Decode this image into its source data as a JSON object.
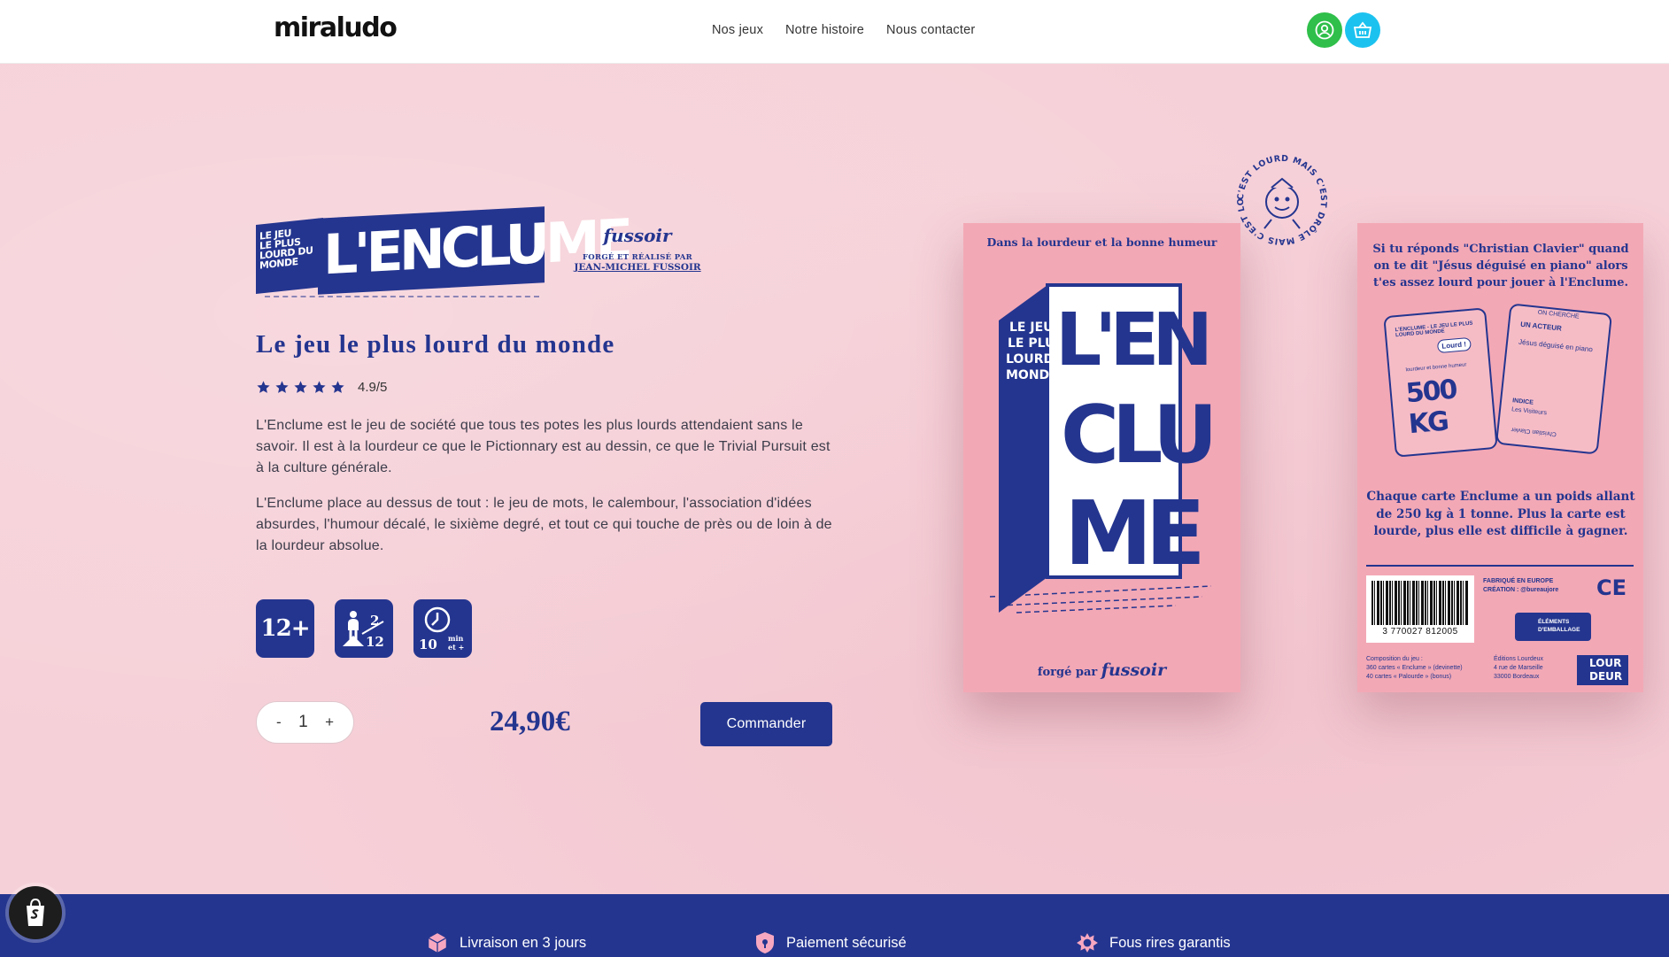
{
  "header": {
    "logo": "miraludo",
    "nav": [
      "Nos jeux",
      "Notre histoire",
      "Nous contacter"
    ],
    "icons": {
      "account": "user-circle-icon",
      "cart": "basket-icon"
    },
    "colors": {
      "account": "#2fbf4a",
      "cart": "#1cc2ef"
    }
  },
  "product": {
    "logo_small_lines": [
      "LE JEU",
      "LE PLUS",
      "LOURD DU",
      "MONDE"
    ],
    "logo_word": "L'ENCLUME",
    "maker_script": "fussoir",
    "maker_credit": "FORGÉ ET RÉALISÉ PAR",
    "maker_name": "JEAN-MICHEL FUSSOIR",
    "headline": "Le jeu le plus lourd du monde",
    "rating": {
      "stars": 5,
      "score": "4.9/5"
    },
    "description": [
      "L'Enclume est le jeu de société que tous tes potes les plus lourds attendaient sans le savoir. Il est à la lourdeur ce que le Pictionnary est au dessin, ce que le Trivial Pursuit est à la culture générale.",
      "L'Enclume place au dessus de tout : le jeu de mots, le calembour, l'association d'idées absurdes, l'humour décalé, le sixième degré, et tout ce qui touche de près ou de loin à de la lourdeur absolue."
    ],
    "badges": [
      {
        "icon": "age-badge-icon",
        "text": "12+"
      },
      {
        "icon": "players-icon",
        "text_top": "2",
        "text_bottom": "12"
      },
      {
        "icon": "clock-icon",
        "text": "10",
        "unit": "min",
        "plus": "et +"
      }
    ],
    "quantity": {
      "minus": "-",
      "value": "1",
      "plus": "+"
    },
    "price": "24,90€",
    "order_label": "Commander",
    "brand_color": "#24358f"
  },
  "box": {
    "front": {
      "tagline": "Dans la lourdeur et la bonne humeur",
      "side_text": [
        "LE JEU",
        "LE PLUS",
        "LOURD DU",
        "MONDE"
      ],
      "title_lines": [
        "L'EN",
        "CLU",
        "ME"
      ],
      "forged_by": "forgé par",
      "maker": "fussoir"
    },
    "back": {
      "intro": "Si tu réponds \"Christian Clavier\" quand on te dit \"Jésus déguisé en piano\" alors t'es assez lourd pour jouer à l'Enclume.",
      "card1_header": "L'ENCLUME - LE JEU LE PLUS LOURD DU MONDE",
      "card1_bubble": "Lourd !",
      "card1_tag": "lourdeur et bonne humeur",
      "card1_weight": "500 KG",
      "card2_search": "ON CHERCHE",
      "card2_title": "UN ACTEUR",
      "card2_clue": "Jésus déguisé en piano",
      "card2_hint_label": "INDICE",
      "card2_hint": "Les Visiteurs",
      "card2_answer": "Christian Clavier",
      "rules": "Chaque carte Enclume a un poids allant de 250 kg à 1 tonne. Plus la carte est lourde, plus elle est difficile à gagner.",
      "barcode": "3 770027 812005",
      "fabrique": "FABRIQUÉ EN EUROPE",
      "creation": "CRÉATION : @bureaujore",
      "ce": "CE",
      "elements": "ÉLÉMENTS D'EMBALLAGE",
      "composition": [
        "Composition du jeu :",
        "360 cartes « Enclume » (devinette)",
        "40 cartes « Palourde » (bonus)"
      ],
      "editor": [
        "Éditions Lourdeux",
        "4 rue de Marseille",
        "33000 Bordeaux"
      ],
      "publisher_logo": [
        "LOUR",
        "DEUR"
      ]
    },
    "stamp_text": "C'EST LOURD MAIS C'EST DRÔLE MAIS C'EST LOURD MAIS"
  },
  "features": [
    {
      "icon": "box-icon",
      "label": "Livraison en 3 jours"
    },
    {
      "icon": "shield-icon",
      "label": "Paiement sécurisé"
    },
    {
      "icon": "flower-icon",
      "label": "Fous rires garantis"
    }
  ],
  "shopify_icon": "shopify-bag-icon"
}
